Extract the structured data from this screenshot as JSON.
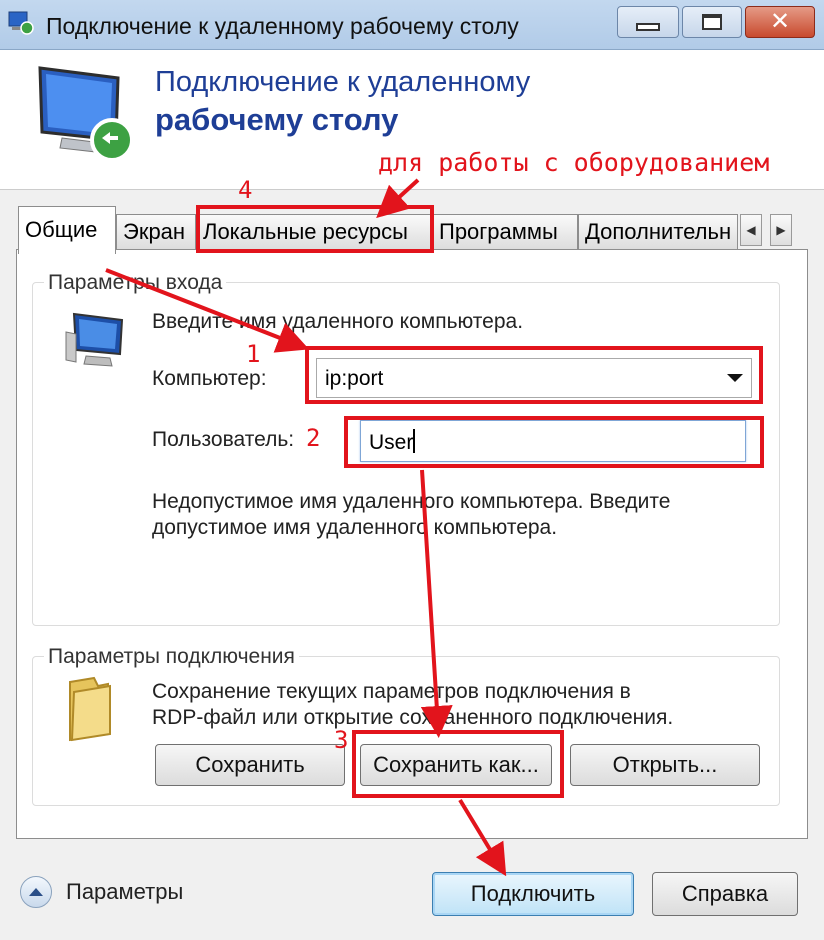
{
  "window": {
    "title": "Подключение к удаленному рабочему столу",
    "buttons": {
      "minimize": "minimize",
      "maximize": "maximize",
      "close": "✕"
    }
  },
  "header": {
    "line1": "Подключение к удаленному",
    "line2": "рабочему столу"
  },
  "annotations": {
    "hint": "для работы с оборудованием",
    "num1": "1",
    "num2": "2",
    "num3": "3",
    "num4": "4",
    "color": "#e2141c"
  },
  "tabs": [
    {
      "label": "Общие",
      "active": true
    },
    {
      "label": "Экран",
      "active": false
    },
    {
      "label": "Локальные ресурсы",
      "active": false
    },
    {
      "label": "Программы",
      "active": false
    },
    {
      "label": "Дополнительн",
      "active": false
    }
  ],
  "tab_scroll": {
    "left": "◀",
    "right": "▶"
  },
  "login_group": {
    "legend": "Параметры входа",
    "prompt": "Введите имя удаленного компьютера.",
    "computer_label": "Компьютер:",
    "computer_value": "ip:port",
    "user_label": "Пользователь:",
    "user_value": "User",
    "error_line1": "Недопустимое имя удаленного компьютера. Введите",
    "error_line2": "допустимое имя удаленного компьютера."
  },
  "connection_group": {
    "legend": "Параметры подключения",
    "desc_line1": "Сохранение текущих параметров подключения в",
    "desc_line2": "RDP-файл или открытие сохраненного подключения.",
    "save_label": "Сохранить",
    "save_as_label": "Сохранить как...",
    "open_label": "Открыть..."
  },
  "footer": {
    "options_label": "Параметры",
    "connect_label": "Подключить",
    "help_label": "Справка"
  }
}
